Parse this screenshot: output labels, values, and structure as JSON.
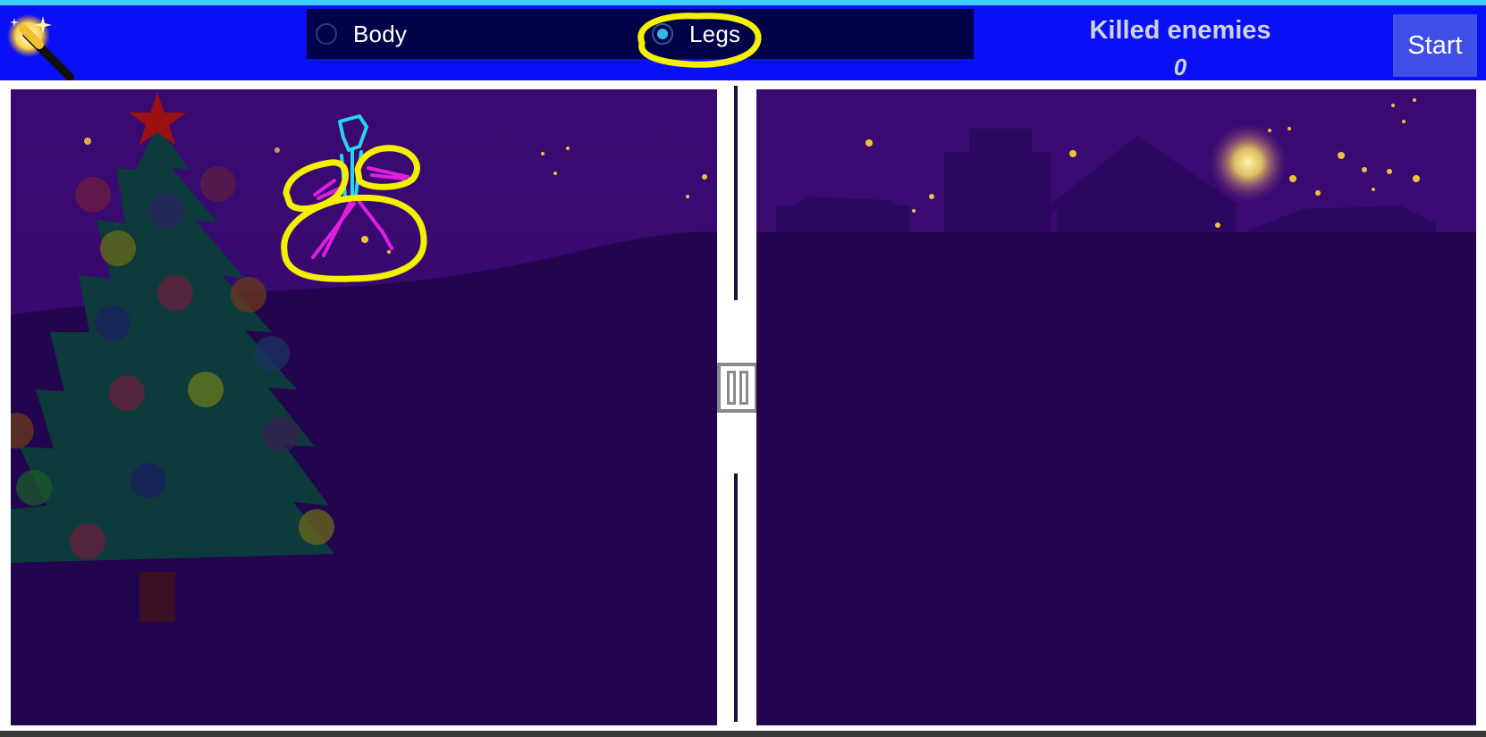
{
  "mode_selector": {
    "options": [
      {
        "label": "Body",
        "checked": false
      },
      {
        "label": "Legs",
        "checked": true
      }
    ]
  },
  "scoreboard": {
    "title": "Killed enemies",
    "count": "0"
  },
  "start_button": {
    "label": "Start"
  },
  "icons": {
    "wand": "magic-wand-icon",
    "pause": "pause-icon"
  },
  "colors": {
    "header": "#0a10f6",
    "night_sky": "#3a0a6e",
    "ground": "#23044f",
    "tree": "#0d3b3c",
    "star": "#9b1111",
    "stroke_body": "#27d4f0",
    "stroke_legs": "#e01ee0",
    "highlight": "#f4f000"
  }
}
